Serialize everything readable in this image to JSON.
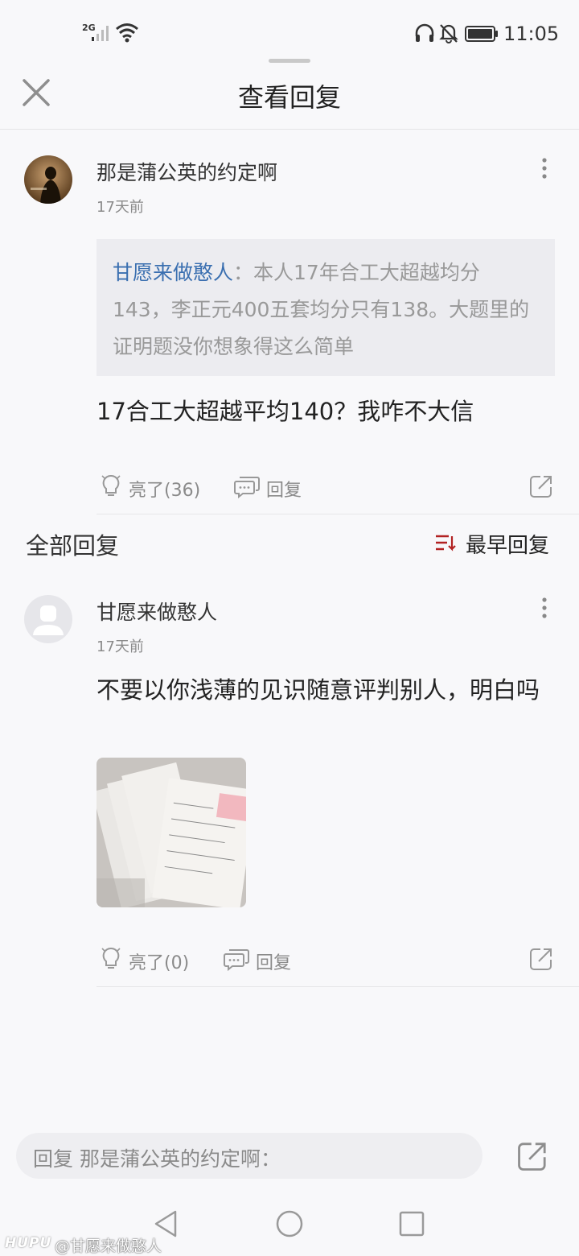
{
  "status_bar": {
    "network": "2G",
    "time": "11:05",
    "icons": [
      "signal-icon",
      "wifi-icon",
      "headphones-icon",
      "mute-bell-icon",
      "battery-icon"
    ]
  },
  "header": {
    "title": "查看回复",
    "close_icon": "close-icon"
  },
  "main_comment": {
    "username": "那是蒲公英的约定啊",
    "time": "17天前",
    "quote": {
      "author": "甘愿来做憨人",
      "separator": "：",
      "text": "本人17年合工大超越均分143，李正元400五套均分只有138。大题里的证明题没你想象得这么简单"
    },
    "text": "17合工大超越平均140？我咋不大信",
    "like_label": "亮了(36)",
    "reply_label": "回复"
  },
  "replies_section": {
    "title": "全部回复",
    "sort_label": "最早回复",
    "accent_color": "#b22222"
  },
  "replies": [
    {
      "username": "甘愿来做憨人",
      "time": "17天前",
      "text": "不要以你浅薄的见识随意评判别人，明白吗",
      "like_label": "亮了(0)",
      "reply_label": "回复"
    }
  ],
  "reply_bar": {
    "placeholder": "回复 那是蒲公英的约定啊："
  },
  "watermark": {
    "logo": "HUPU",
    "text": "@甘愿来做憨人"
  }
}
